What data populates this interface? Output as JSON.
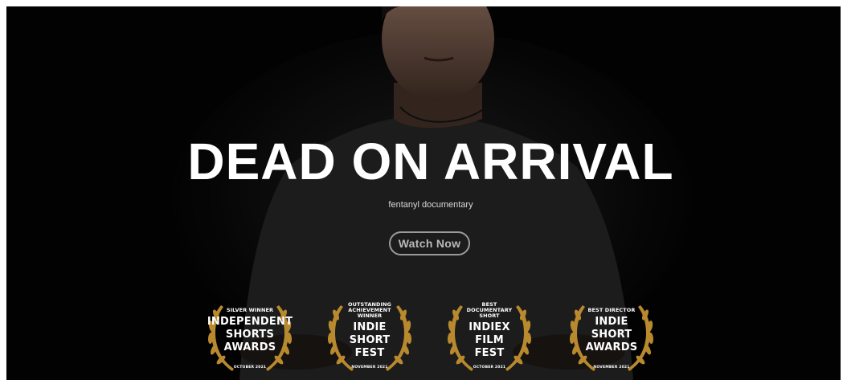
{
  "hero": {
    "title": "DEAD ON ARRIVAL",
    "subtitle": "fentanyl documentary",
    "cta_label": "Watch Now"
  },
  "laurels": [
    {
      "top": "SILVER WINNER",
      "name": "INDEPENDENT\nSHORTS\nAWARDS",
      "date": "OCTOBER 2021"
    },
    {
      "top": "OUTSTANDING ACHIEVEMENT WINNER",
      "name": "INDIE\nSHORT\nFEST",
      "date": "NOVEMBER 2021"
    },
    {
      "top": "BEST DOCUMENTARY SHORT",
      "name": "INDIEX\nFILM\nFEST",
      "date": "OCTOBER 2021"
    },
    {
      "top": "BEST DIRECTOR",
      "name": "INDIE\nSHORT\nAWARDS",
      "date": "NOVEMBER 2021"
    }
  ],
  "colors": {
    "background": "#030303",
    "laurel_gold": "#b8892e",
    "text": "#ffffff"
  }
}
